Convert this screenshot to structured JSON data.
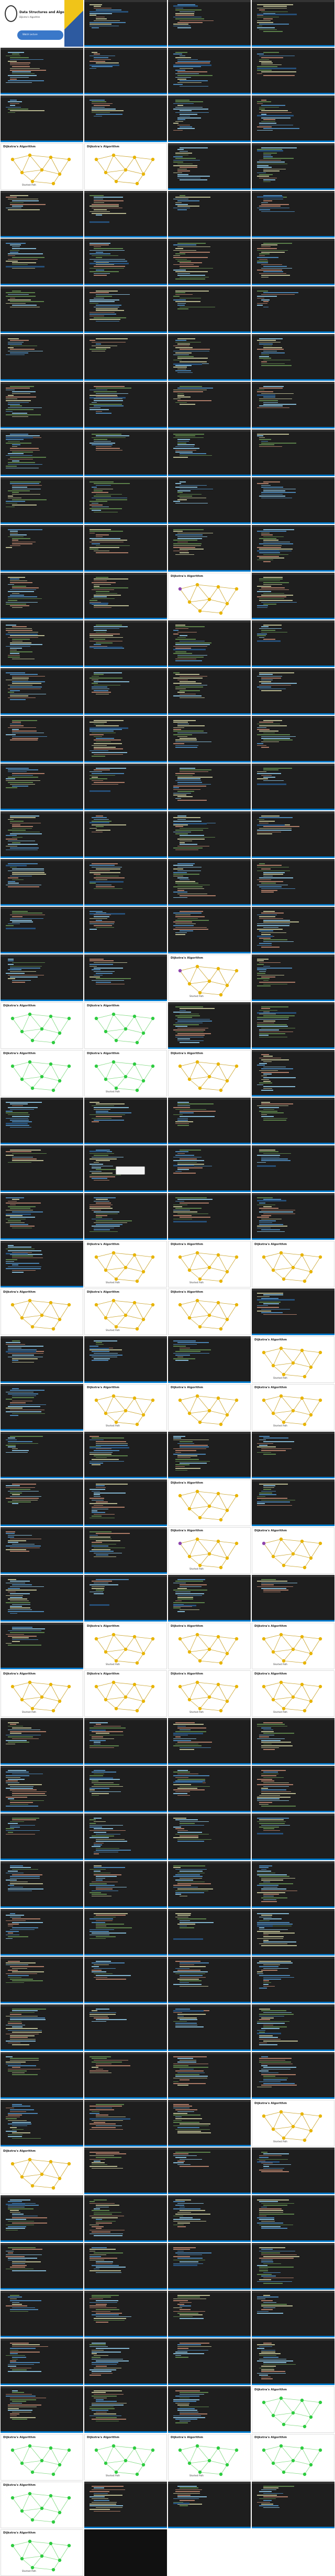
{
  "cover": {
    "title": "Data Structures and Algorithms",
    "subtitle": "Dijkstra's Algorithm",
    "button_label": "Watch Lecture"
  },
  "graph_title": "Dijkstra's Algorithm",
  "graph_caption": "Shortest Path",
  "colors": {
    "editor_bg": "#1e1e1e",
    "accent": "#007acc",
    "node_yellow": "#e8b400",
    "node_green": "#2ecc40",
    "node_purple": "#8e44ad",
    "edge": "#c9a227"
  },
  "tiles": [
    "cover",
    "code",
    "code",
    "code",
    "code",
    "code",
    "code",
    "code",
    "code",
    "code",
    "code",
    "code",
    "graph",
    "graph",
    "code",
    "code",
    "code",
    "code",
    "code",
    "code",
    "code",
    "code",
    "code",
    "code",
    "code",
    "code",
    "code",
    "code",
    "code",
    "code",
    "code",
    "code",
    "code",
    "code",
    "code",
    "code",
    "code",
    "code",
    "code",
    "code",
    "code",
    "code",
    "code",
    "code",
    "code",
    "code",
    "code",
    "code",
    "code",
    "code",
    "graph-purple",
    "code",
    "code",
    "code",
    "code",
    "code",
    "code",
    "code",
    "code",
    "code",
    "code",
    "code",
    "code",
    "code",
    "code",
    "code",
    "code",
    "code",
    "code",
    "code",
    "code",
    "code",
    "code",
    "code",
    "code",
    "code",
    "code",
    "code",
    "code",
    "code",
    "code",
    "code",
    "graph-purple",
    "code",
    "graph-green",
    "graph-green",
    "code",
    "code",
    "graph-green",
    "graph-green",
    "graph",
    "code",
    "code",
    "code",
    "code",
    "code",
    "code",
    "code-tooltip",
    "code",
    "code",
    "code",
    "code",
    "code",
    "code",
    "code",
    "graph",
    "graph",
    "graph",
    "graph",
    "graph",
    "graph",
    "code",
    "code",
    "code",
    "code",
    "graph",
    "code",
    "graph",
    "graph",
    "graph",
    "code",
    "code",
    "code",
    "code",
    "code",
    "code",
    "graph",
    "code",
    "code",
    "code",
    "graph-purple",
    "graph-purple",
    "code",
    "code",
    "code",
    "code",
    "code",
    "graph",
    "graph",
    "graph",
    "graph",
    "graph",
    "graph",
    "graph",
    "code",
    "code",
    "code",
    "code",
    "code",
    "code",
    "code",
    "code",
    "code",
    "code",
    "code",
    "code",
    "code",
    "code",
    "code",
    "code",
    "code",
    "code",
    "code",
    "code",
    "code",
    "code",
    "code",
    "code",
    "code",
    "code",
    "code",
    "code",
    "code",
    "code",
    "code",
    "code",
    "code",
    "code",
    "code",
    "graph",
    "graph",
    "code",
    "code",
    "code",
    "code",
    "code",
    "code",
    "code",
    "code",
    "code",
    "code",
    "code",
    "code",
    "code",
    "code",
    "code",
    "code",
    "code",
    "code",
    "code",
    "code",
    "code",
    "code",
    "graph-green",
    "graph-green",
    "graph-green",
    "graph-green",
    "graph-green",
    "graph-green",
    "code",
    "code",
    "code",
    "graph-green",
    "dark"
  ]
}
